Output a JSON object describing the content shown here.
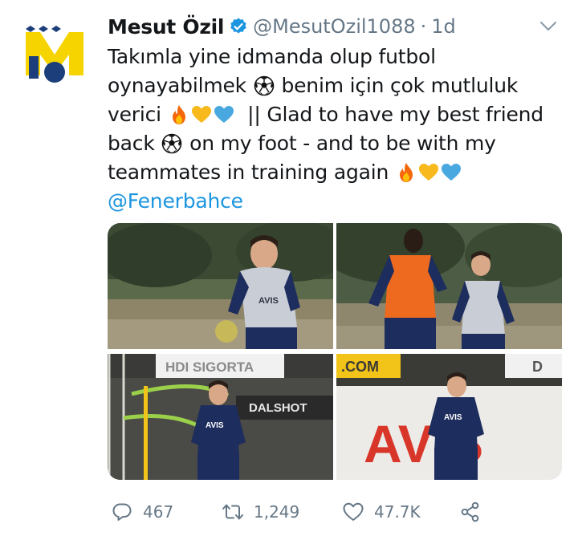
{
  "tweet": {
    "author_name": "Mesut Özil",
    "handle": "@MesutOzil1088",
    "separator": "·",
    "time": "1d",
    "lines": [
      "Takımla yine idmanda olup futbol",
      "oynayabilmek",
      "benim için çok mutluluk",
      "verici",
      "|| Glad to have my best friend",
      "back",
      "on my foot - and to be with my",
      "teammates in training again"
    ],
    "mention": "@Fenerbahce"
  },
  "media": {
    "photo_texts": [
      "AVIS",
      "HDI SIGORTA",
      "DALSHOT",
      "AVIS",
      ".COM",
      "D",
      "AVIS",
      "AVIS"
    ]
  },
  "actions": {
    "replies": "467",
    "retweets": "1,249",
    "likes": "47.7K"
  },
  "colors": {
    "accent": "#1b95e0",
    "muted": "#657786",
    "text": "#14171a",
    "avatar_yellow": "#f5d400",
    "avatar_blue": "#1c3f7c"
  },
  "icons": [
    "verified-badge-icon",
    "chevron-down-icon",
    "reply-icon",
    "retweet-icon",
    "like-icon",
    "share-icon",
    "soccer-ball-emoji",
    "fire-emoji",
    "yellow-heart-emoji",
    "blue-heart-emoji"
  ]
}
